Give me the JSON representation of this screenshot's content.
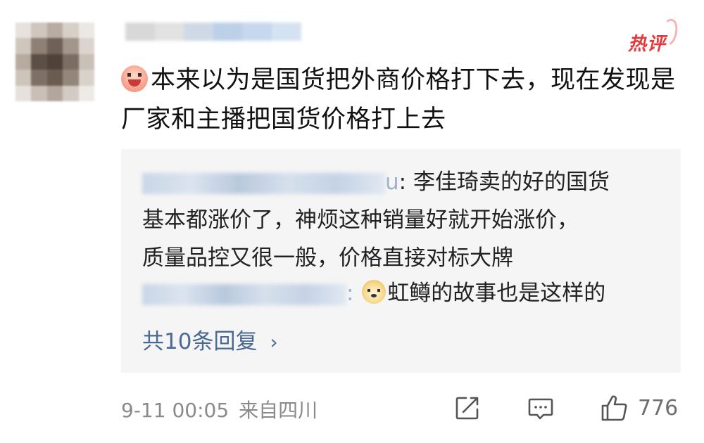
{
  "badge": {
    "label": "热评",
    "color": "#e4393c"
  },
  "comment": {
    "emoji": "pig-laugh-emoji",
    "text": "本来以为是国货把外商价格打下去，现在发现是厂家和主播把国货价格打上去"
  },
  "replies": [
    {
      "author_blurred": true,
      "author_tail": "u",
      "separator": ":",
      "lines": [
        "李佳琦卖的好的国货",
        "基本都涨价了，神烦这种销量好就开始涨价，",
        "质量品控又很一般，价格直接对标大牌"
      ]
    },
    {
      "author_blurred": true,
      "separator": ":",
      "emoji": "doge-emoji",
      "text": "虹鳟的故事也是这样的"
    }
  ],
  "more_replies": {
    "label": "共10条回复",
    "chevron": "›",
    "color": "#4a6a94"
  },
  "footer": {
    "time": "9-11 00:05",
    "location": "来自四川",
    "like_count": "776",
    "icons": [
      "share-icon",
      "comment-icon",
      "like-icon"
    ]
  }
}
